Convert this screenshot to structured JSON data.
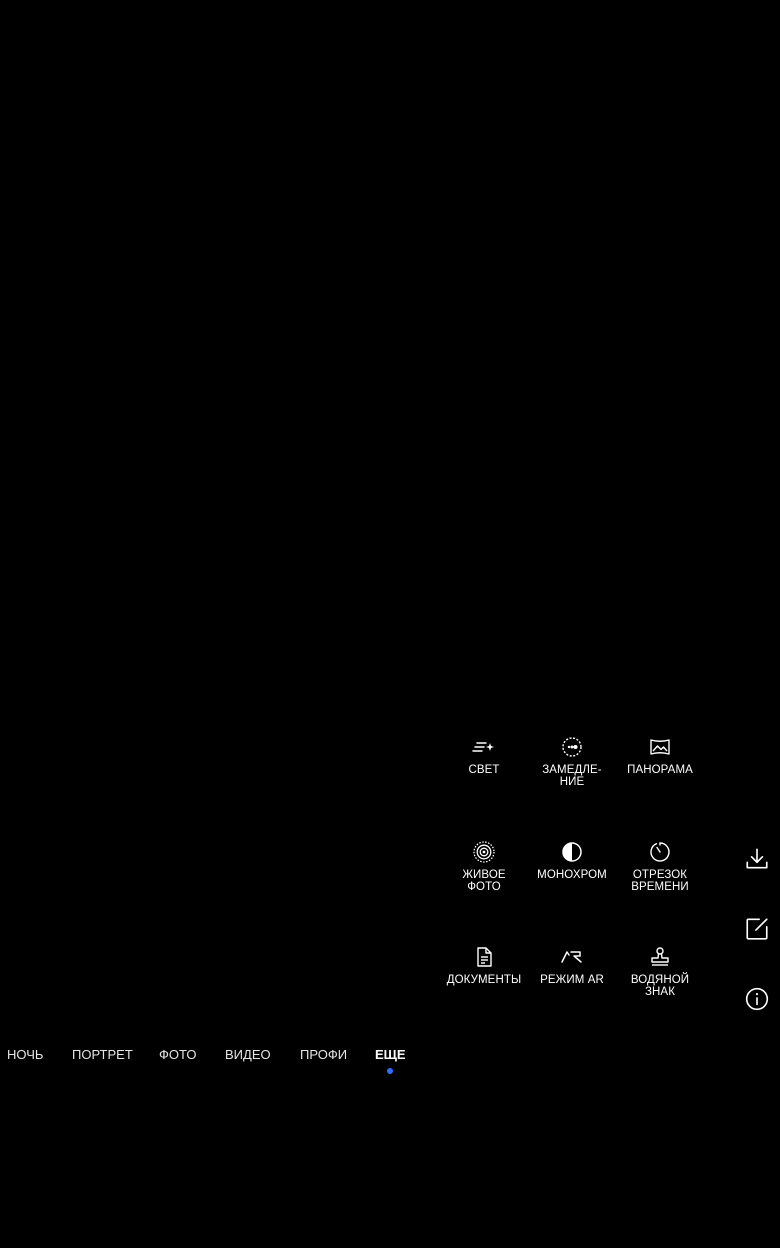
{
  "colors": {
    "background": "#000000",
    "text": "#ffffff",
    "accent": "#2f6bff"
  },
  "more_modes": [
    {
      "id": "light",
      "label": "СВЕТ",
      "icon": "light-painting-icon"
    },
    {
      "id": "slowmo",
      "label": "ЗАМЕДЛЕ-\nНИЕ",
      "icon": "slow-motion-icon"
    },
    {
      "id": "panorama",
      "label": "ПАНОРАМА",
      "icon": "panorama-icon"
    },
    {
      "id": "live",
      "label": "ЖИВОЕ\nФОТО",
      "icon": "live-photo-icon"
    },
    {
      "id": "mono",
      "label": "МОНОХРОМ",
      "icon": "monochrome-icon"
    },
    {
      "id": "timelapse",
      "label": "ОТРЕЗОК\nВРЕМЕНИ",
      "icon": "timelapse-icon"
    },
    {
      "id": "docs",
      "label": "ДОКУМЕНТЫ",
      "icon": "document-icon"
    },
    {
      "id": "ar",
      "label": "РЕЖИМ AR",
      "icon": "ar-icon"
    },
    {
      "id": "watermark",
      "label": "ВОДЯНОЙ\nЗНАК",
      "icon": "watermark-stamp-icon"
    }
  ],
  "side_actions": [
    {
      "id": "download",
      "icon": "download-icon"
    },
    {
      "id": "edit",
      "icon": "edit-icon"
    },
    {
      "id": "info",
      "icon": "info-icon"
    }
  ],
  "mode_bar": {
    "items": [
      "НОЧЬ",
      "ПОРТРЕТ",
      "ФОТО",
      "ВИДЕО",
      "ПРОФИ",
      "ЕЩЕ"
    ],
    "active": "ЕЩЕ"
  }
}
